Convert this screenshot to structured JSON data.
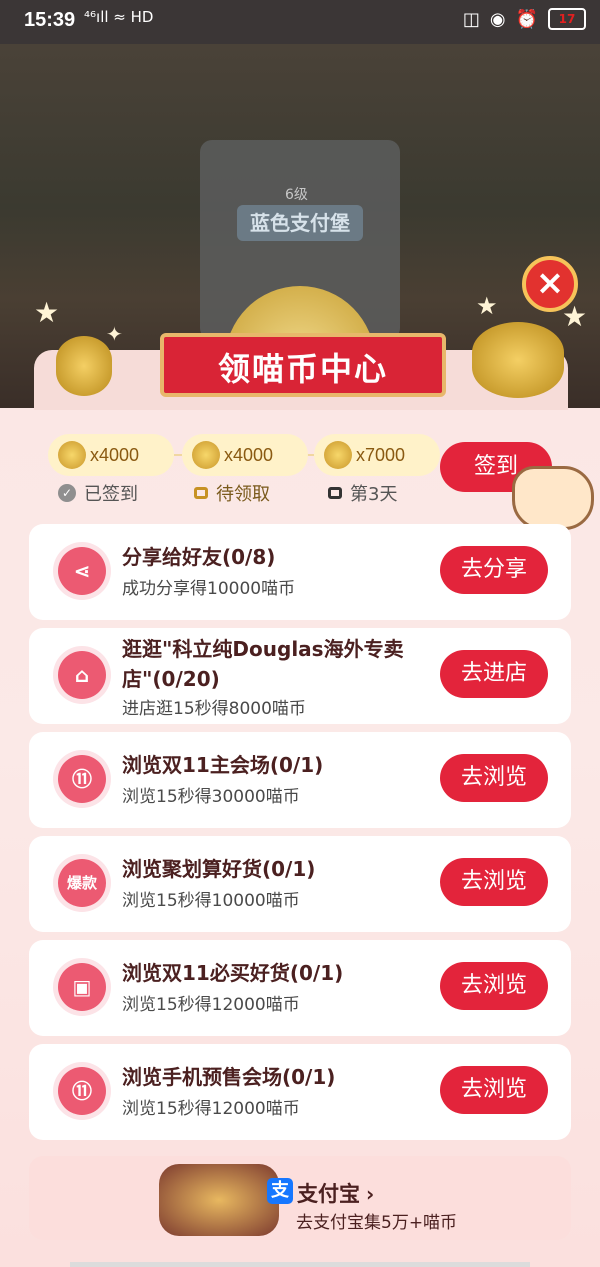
{
  "status_bar": {
    "time": "15:39",
    "signal": "⁴⁶ıll ≈ HD",
    "battery": "17"
  },
  "game": {
    "level": "6级",
    "castle_name": "蓝色支付堡"
  },
  "panel": {
    "title": "领喵币中心",
    "checkin": {
      "days": [
        {
          "amount": "x4000",
          "status": "已签到"
        },
        {
          "amount": "x4000",
          "status": "待领取"
        },
        {
          "amount": "x7000",
          "status": "第3天"
        }
      ],
      "button": "签到"
    },
    "tasks": [
      {
        "icon": "share-icon",
        "icon_glyph": "⋖",
        "title": "分享给好友(0/8)",
        "subtitle": "成功分享得10000喵币",
        "button": "去分享"
      },
      {
        "icon": "shop-icon",
        "icon_glyph": "⌂",
        "title": "逛逛\"科立纯Douglas海外专卖店\"(0/20)",
        "subtitle": "进店逛15秒得8000喵币",
        "button": "去进店"
      },
      {
        "icon": "double11-icon",
        "icon_glyph": "⑪",
        "title": "浏览双11主会场(0/1)",
        "subtitle": "浏览15秒得30000喵币",
        "button": "去浏览"
      },
      {
        "icon": "hot-item-icon",
        "icon_glyph": "爆款",
        "title": "浏览聚划算好货(0/1)",
        "subtitle": "浏览15秒得10000喵币",
        "button": "去浏览"
      },
      {
        "icon": "shopping-bag-icon",
        "icon_glyph": "▣",
        "title": "浏览双11必买好货(0/1)",
        "subtitle": "浏览15秒得12000喵币",
        "button": "去浏览"
      },
      {
        "icon": "double11-icon",
        "icon_glyph": "⑪",
        "title": "浏览手机预售会场(0/1)",
        "subtitle": "浏览15秒得12000喵币",
        "button": "去浏览"
      }
    ],
    "promo": {
      "brand": "支付宝",
      "subtitle": "去支付宝集5万+喵币"
    }
  }
}
